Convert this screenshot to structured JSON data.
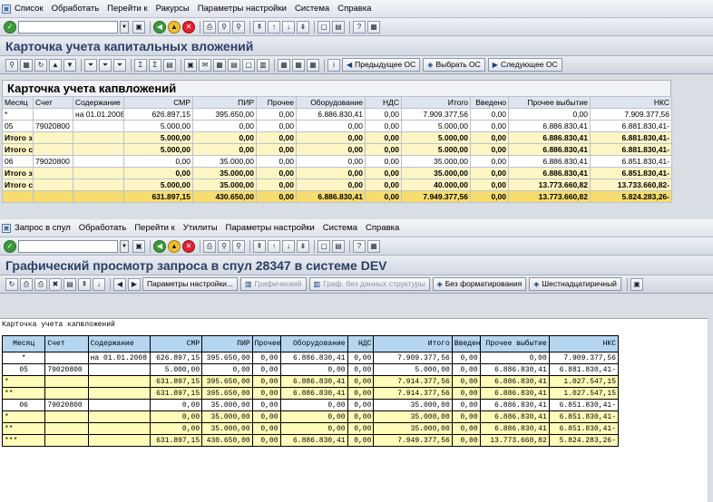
{
  "window1": {
    "menu": [
      "Список",
      "Обработать",
      "Перейти к",
      "Ракурсы",
      "Параметры настройки",
      "Система",
      "Справка"
    ],
    "title": "Карточка учета капитальных вложений",
    "app_buttons": {
      "prev": "Предыдущее ОС",
      "select": "Выбрать ОС",
      "next": "Следующее ОС"
    },
    "alv_title": "Карточка учета капвложений",
    "columns": [
      "Месяц",
      "Счет",
      "Содержание",
      "СМР",
      "ПИР",
      "Прочее",
      "Оборудование",
      "НДС",
      "Итого",
      "Введено",
      "Прочее выбытие",
      "НКС"
    ],
    "rows": [
      {
        "type": "data",
        "c": [
          "*",
          "",
          "на 01.01.2008",
          "626.897,15",
          "395.650,00",
          "0,00",
          "6.886.830,41",
          "0,00",
          "7.909.377,56",
          "0,00",
          "0,00",
          "7.909.377,56"
        ]
      },
      {
        "type": "data",
        "c": [
          "05",
          "79020800",
          "",
          "5.000,00",
          "0,00",
          "0,00",
          "0,00",
          "0,00",
          "5.000,00",
          "0,00",
          "6.886.830,41",
          "6.881.830,41-"
        ]
      },
      {
        "type": "sub",
        "c": [
          "Итого за месяц",
          "",
          "",
          "5.000,00",
          "0,00",
          "0,00",
          "0,00",
          "0,00",
          "5.000,00",
          "0,00",
          "6.886.830,41",
          "6.881.830,41-"
        ]
      },
      {
        "type": "sub",
        "c": [
          "Итого с начала года",
          "",
          "",
          "5.000,00",
          "0,00",
          "0,00",
          "0,00",
          "0,00",
          "5.000,00",
          "0,00",
          "6.886.830,41",
          "6.881.830,41-"
        ]
      },
      {
        "type": "data",
        "c": [
          "06",
          "79020800",
          "",
          "0,00",
          "35.000,00",
          "0,00",
          "0,00",
          "0,00",
          "35.000,00",
          "0,00",
          "6.886.830,41",
          "6.851.830,41-"
        ]
      },
      {
        "type": "sub",
        "c": [
          "Итого за месяц",
          "",
          "",
          "0,00",
          "35.000,00",
          "0,00",
          "0,00",
          "0,00",
          "35.000,00",
          "0,00",
          "6.886.830,41",
          "6.851.830,41-"
        ]
      },
      {
        "type": "sub",
        "c": [
          "Итого с начала года",
          "",
          "",
          "5.000,00",
          "35.000,00",
          "0,00",
          "0,00",
          "0,00",
          "40.000,00",
          "0,00",
          "13.773.660,82",
          "13.733.660,82-"
        ]
      },
      {
        "type": "tot",
        "c": [
          "",
          "",
          "",
          "631.897,15",
          "430.650,00",
          "0,00",
          "6.886.830,41",
          "0,00",
          "7.949.377,56",
          "0,00",
          "13.773.660,82",
          "5.824.283,26-"
        ]
      }
    ]
  },
  "window2": {
    "menu": [
      "Запрос в спул",
      "Обработать",
      "Перейти к",
      "Утилиты",
      "Параметры настройки",
      "Система",
      "Справка"
    ],
    "title": "Графический просмотр запроса в спул 28347 в системе DEV",
    "buttons": {
      "settings": "Параметры настройки...",
      "graphic": "Графический",
      "graph_nostruct": "Граф. без данных структуры",
      "noformat": "Без форматирования",
      "hex": "Шестнадцатиричный"
    },
    "spool_title": "Карточка учета капвложений",
    "columns": [
      "Месяц",
      "Счет",
      "Содержание",
      "СМР",
      "ПИР",
      "Прочее",
      "Оборудование",
      "НДС",
      "Итого",
      "Введено",
      "Прочее выбытие",
      "НКС"
    ],
    "rows": [
      {
        "type": "w",
        "c": [
          "*",
          "",
          "на 01.01.2008",
          "626.897,15",
          "395.650,00",
          "0,00",
          "6.886.830,41",
          "0,00",
          "7.909.377,56",
          "0,00",
          "0,00",
          "7.909.377,56"
        ]
      },
      {
        "type": "w",
        "c": [
          "05",
          "79020800",
          "",
          "5.000,00",
          "0,00",
          "0,00",
          "0,00",
          "0,00",
          "5.000,00",
          "0,00",
          "6.886.830,41",
          "6.881.830,41-"
        ]
      },
      {
        "type": "y",
        "c": [
          "*",
          "",
          "",
          "631.897,15",
          "395.650,00",
          "0,00",
          "6.886.830,41",
          "0,00",
          "7.914.377,56",
          "0,00",
          "6.886.830,41",
          "1.027.547,15"
        ]
      },
      {
        "type": "y",
        "c": [
          "**",
          "",
          "",
          "631.897,15",
          "395.650,00",
          "0,00",
          "6.886.830,41",
          "0,00",
          "7.914.377,56",
          "0,00",
          "6.886.830,41",
          "1.027.547,15"
        ]
      },
      {
        "type": "w",
        "c": [
          "06",
          "79020800",
          "",
          "0,00",
          "35.000,00",
          "0,00",
          "0,00",
          "0,00",
          "35.000,00",
          "0,00",
          "6.886.830,41",
          "6.851.830,41-"
        ]
      },
      {
        "type": "y",
        "c": [
          "*",
          "",
          "",
          "0,00",
          "35.000,00",
          "0,00",
          "0,00",
          "0,00",
          "35.000,00",
          "0,00",
          "6.886.830,41",
          "6.851.830,41-"
        ]
      },
      {
        "type": "y",
        "c": [
          "**",
          "",
          "",
          "0,00",
          "35.000,00",
          "0,00",
          "0,00",
          "0,00",
          "35.000,00",
          "0,00",
          "6.886.830,41",
          "6.851.830,41-"
        ]
      },
      {
        "type": "y",
        "c": [
          "***",
          "",
          "",
          "631.897,15",
          "430.650,00",
          "0,00",
          "6.886.830,41",
          "0,00",
          "7.949.377,56",
          "0,00",
          "13.773.660,82",
          "5.824.283,26-"
        ]
      }
    ]
  }
}
